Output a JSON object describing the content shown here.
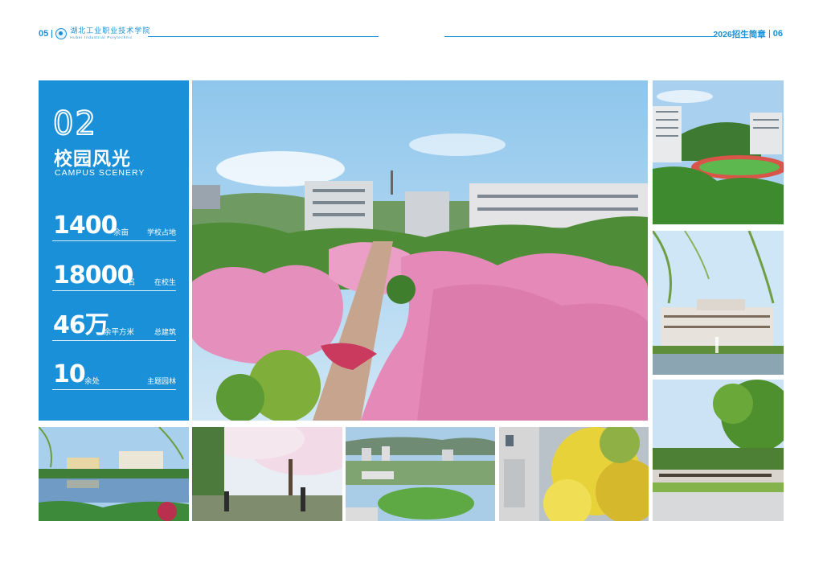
{
  "header": {
    "left_page_number": "05",
    "school_name_cn": "湖北工业职业技术学院",
    "school_name_en": "Hubei Industrial Polytechnic",
    "brochure_title": "2026招生简章",
    "right_page_number": "06"
  },
  "section": {
    "number": "02",
    "title_cn": "校园风光",
    "title_en": "CAMPUS SCENERY"
  },
  "stats": [
    {
      "value": "1400",
      "unit": "余亩",
      "desc": "学校占地"
    },
    {
      "value": "18000",
      "unit": "名",
      "desc": "在校生"
    },
    {
      "value": "46万",
      "unit": "余平方米",
      "desc": "总建筑"
    },
    {
      "value": "10",
      "unit": "余处",
      "desc": "主题园林"
    }
  ],
  "colors": {
    "accent": "#1a90d8",
    "blossom": "#e98ab8",
    "sky": "#9fd0ee",
    "foliage": "#4e8f3a"
  }
}
